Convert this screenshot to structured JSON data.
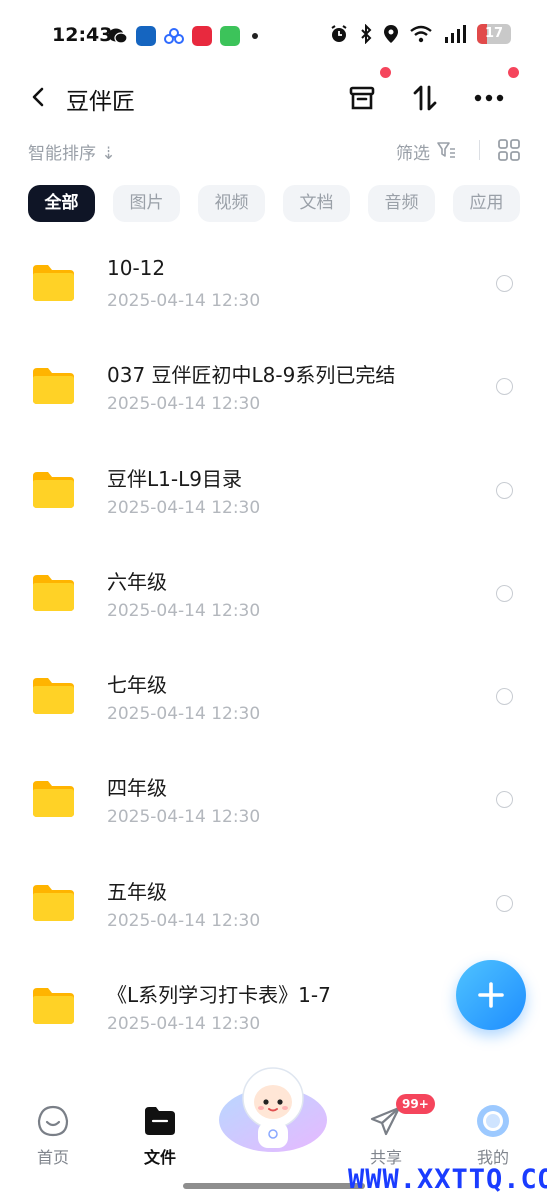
{
  "status_bar": {
    "time": "12:43",
    "battery": "17"
  },
  "header": {
    "title": "豆伴匠"
  },
  "toolbar": {
    "sort_label": "智能排序 ⇣",
    "filter_label": "筛选"
  },
  "tabs": [
    "全部",
    "图片",
    "视频",
    "文档",
    "音频",
    "应用"
  ],
  "files": [
    {
      "name": "10-12",
      "date": "2025-04-14  12:30"
    },
    {
      "name": "037 豆伴匠初中L8-9系列已完结",
      "date": "2025-04-14  12:30"
    },
    {
      "name": "豆伴L1-L9目录",
      "date": "2025-04-14  12:30"
    },
    {
      "name": "六年级",
      "date": "2025-04-14  12:30"
    },
    {
      "name": "七年级",
      "date": "2025-04-14  12:30"
    },
    {
      "name": "四年级",
      "date": "2025-04-14  12:30"
    },
    {
      "name": "五年级",
      "date": "2025-04-14  12:30"
    },
    {
      "name": "《L系列学习打卡表》1-7",
      "date": "2025-04-14  12:30"
    }
  ],
  "bottom_nav": {
    "home": "首页",
    "files": "文件",
    "share": "共享",
    "mine": "我的",
    "share_badge": "99+"
  },
  "watermark": "WWW.XXTTQ.COM",
  "colors": {
    "accent": "#1e8dff",
    "active_tab": "#0f1526",
    "folder": "#ffc400",
    "badge": "#f5455c"
  }
}
